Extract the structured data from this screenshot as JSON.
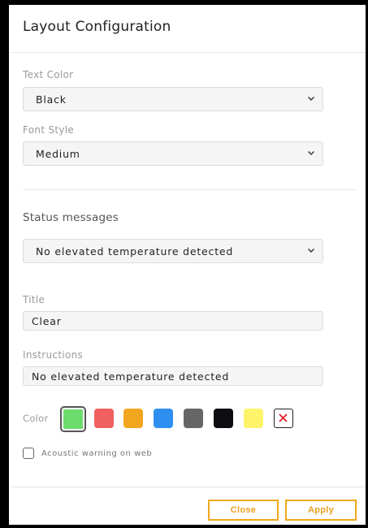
{
  "dialog": {
    "title": "Layout Configuration"
  },
  "text_color": {
    "label": "Text Color",
    "value": "Black"
  },
  "font_style": {
    "label": "Font Style",
    "value": "Medium"
  },
  "status": {
    "section_title": "Status messages",
    "value": "No elevated temperature detected"
  },
  "title_field": {
    "label": "Title",
    "value": "Clear"
  },
  "instructions_field": {
    "label": "Instructions",
    "value": "No elevated temperature detected"
  },
  "color": {
    "label": "Color",
    "swatches": [
      "#6cdc6c",
      "#f06060",
      "#f2a620",
      "#2f8ff0",
      "#666666",
      "#0d0d12",
      "#fff36a"
    ],
    "selected_index": 0
  },
  "acoustic": {
    "label": "Acoustic warning on web",
    "checked": false
  },
  "buttons": {
    "close": "Close",
    "apply": "Apply"
  },
  "icons": {
    "dropdown": "chevron-down-icon",
    "no_color": "close-icon"
  },
  "accent_color": "#f0a81c"
}
